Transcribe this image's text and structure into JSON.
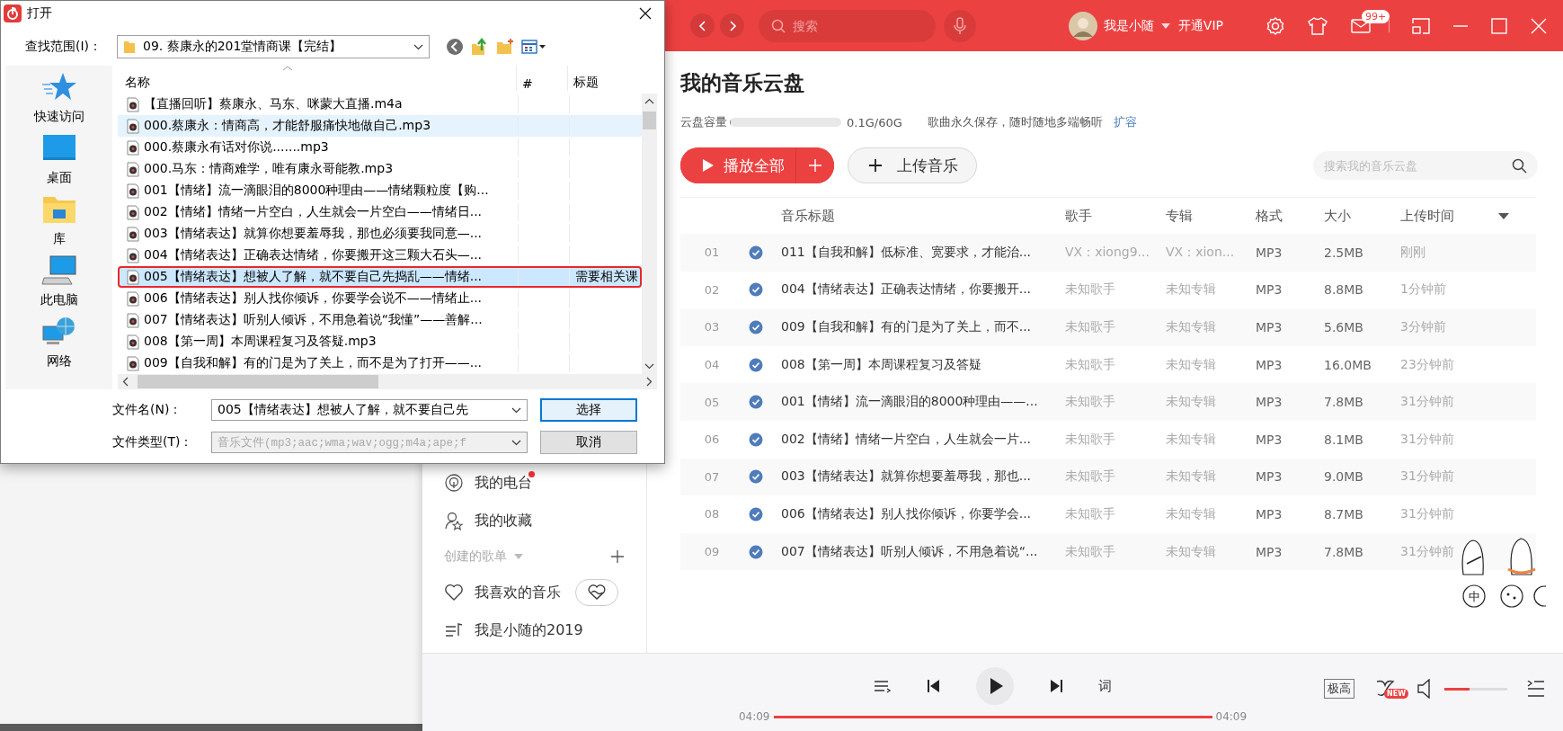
{
  "dialog": {
    "title": "打开",
    "look_in_label": "查找范围(I)：",
    "look_in_value": "09. 蔡康永的201堂情商课【完结】",
    "places": [
      {
        "label": "快速访问",
        "kind": "star"
      },
      {
        "label": "桌面",
        "kind": "desktop"
      },
      {
        "label": "库",
        "kind": "library"
      },
      {
        "label": "此电脑",
        "kind": "computer"
      },
      {
        "label": "网络",
        "kind": "network"
      }
    ],
    "columns": [
      "名称",
      "#",
      "标题"
    ],
    "files": [
      {
        "name": "【直播回听】蔡康永、马东、咪蒙大直播.m4a",
        "selected": false,
        "hovered": false,
        "marked": false
      },
      {
        "name": "000.蔡康永：情商高，才能舒服痛快地做自己.mp3",
        "selected": false,
        "hovered": true,
        "marked": false
      },
      {
        "name": "000.蔡康永有话对你说.......mp3",
        "selected": false,
        "hovered": false,
        "marked": false
      },
      {
        "name": "000.马东：情商难学，唯有康永哥能教.mp3",
        "selected": false,
        "hovered": false,
        "marked": false
      },
      {
        "name": "001【情绪】流一滴眼泪的8000种理由——情绪颗粒度【购...",
        "selected": false,
        "hovered": false,
        "marked": false
      },
      {
        "name": "002【情绪】情绪一片空白，人生就会一片空白——情绪日...",
        "selected": false,
        "hovered": false,
        "marked": false
      },
      {
        "name": "003【情绪表达】就算你想要羞辱我，那也必须要我同意—...",
        "selected": false,
        "hovered": false,
        "marked": false
      },
      {
        "name": "004【情绪表达】正确表达情绪，你要搬开这三颗大石头—...",
        "selected": false,
        "hovered": false,
        "marked": false
      },
      {
        "name": "005【情绪表达】想被人了解，就不要自己先捣乱——情绪...",
        "title": "需要相关课",
        "selected": true,
        "hovered": false,
        "marked": true
      },
      {
        "name": "006【情绪表达】别人找你倾诉，你要学会说不——情绪止...",
        "selected": false,
        "hovered": false,
        "marked": false
      },
      {
        "name": "007【情绪表达】听别人倾诉，不用急着说“我懂”——善解...",
        "selected": false,
        "hovered": false,
        "marked": false
      },
      {
        "name": "008【第一周】本周课程复习及答疑.mp3",
        "selected": false,
        "hovered": false,
        "marked": false
      },
      {
        "name": "009【自我和解】有的门是为了关上，而不是为了打开——...",
        "selected": false,
        "hovered": false,
        "marked": false
      }
    ],
    "file_name_label": "文件名(N)：",
    "file_name_value": "005【情绪表达】想被人了解，就不要自己先",
    "file_type_label": "文件类型(T)：",
    "file_type_value": "音乐文件(mp3;aac;wma;wav;ogg;m4a;ape;f",
    "buttons": [
      {
        "label": "选择",
        "default": true
      },
      {
        "label": "取消",
        "default": false
      }
    ]
  },
  "app": {
    "search_placeholder": "搜索",
    "user": "我是小随",
    "vip": "开通VIP",
    "mail_badge": "99+",
    "sidebar": {
      "items": [
        {
          "label": "我的电台",
          "kind": "radio",
          "dot": true
        },
        {
          "label": "我的收藏",
          "kind": "collect",
          "dot": false
        }
      ],
      "section": "创建的歌单",
      "playlists": [
        {
          "label": "我喜欢的音乐",
          "kind": "liked"
        },
        {
          "label": "我是小随的2019",
          "kind": "playlist"
        }
      ]
    },
    "page": {
      "title": "我的音乐云盘",
      "capacity_label": "云盘容量",
      "capacity": {
        "level": 0.01
      },
      "capacity_text": "0.1G/60G",
      "slogan": "歌曲永久保存，随时随地多端畅听",
      "expand_link": "扩容",
      "play_all": "播放全部",
      "upload": "上传音乐",
      "search_placeholder": "搜索我的音乐云盘"
    },
    "columns": [
      "音乐标题",
      "歌手",
      "专辑",
      "格式",
      "大小",
      "上传时间"
    ],
    "tracks": [
      {
        "index": "01",
        "checked": true,
        "title": "011【自我和解】低标准、宽要求，才能治...",
        "artist": "VX：xiong9...",
        "album": "VX：xion...",
        "format": "MP3",
        "size": "2.5MB",
        "time": "刚刚"
      },
      {
        "index": "02",
        "checked": true,
        "title": "004【情绪表达】正确表达情绪，你要搬开...",
        "artist": "未知歌手",
        "album": "未知专辑",
        "format": "MP3",
        "size": "8.8MB",
        "time": "1分钟前"
      },
      {
        "index": "03",
        "checked": true,
        "title": "009【自我和解】有的门是为了关上，而不...",
        "artist": "未知歌手",
        "album": "未知专辑",
        "format": "MP3",
        "size": "5.6MB",
        "time": "3分钟前"
      },
      {
        "index": "04",
        "checked": true,
        "title": "008【第一周】本周课程复习及答疑",
        "artist": "未知歌手",
        "album": "未知专辑",
        "format": "MP3",
        "size": "16.0MB",
        "time": "23分钟前"
      },
      {
        "index": "05",
        "checked": true,
        "title": "001【情绪】流一滴眼泪的8000种理由——...",
        "artist": "未知歌手",
        "album": "未知专辑",
        "format": "MP3",
        "size": "7.8MB",
        "time": "31分钟前"
      },
      {
        "index": "06",
        "checked": true,
        "title": "002【情绪】情绪一片空白，人生就会一片...",
        "artist": "未知歌手",
        "album": "未知专辑",
        "format": "MP3",
        "size": "8.1MB",
        "time": "31分钟前"
      },
      {
        "index": "07",
        "checked": true,
        "title": "003【情绪表达】就算你想要羞辱我，那也...",
        "artist": "未知歌手",
        "album": "未知专辑",
        "format": "MP3",
        "size": "9.0MB",
        "time": "31分钟前"
      },
      {
        "index": "08",
        "checked": true,
        "title": "006【情绪表达】别人找你倾诉，你要学会...",
        "artist": "未知歌手",
        "album": "未知专辑",
        "format": "MP3",
        "size": "8.7MB",
        "time": "31分钟前"
      },
      {
        "index": "09",
        "checked": true,
        "title": "007【情绪表达】听别人倾诉，不用急着说“...",
        "artist": "未知歌手",
        "album": "未知专辑",
        "format": "MP3",
        "size": "7.8MB",
        "time": "31分钟前"
      }
    ],
    "player": {
      "elapsed": "04:09",
      "total": "04:09",
      "progress": {
        "level": 1
      },
      "lyrics": "词",
      "quality": "极高",
      "effect_badge": "NEW",
      "volume": {
        "level": 0.4
      }
    },
    "sticker": {
      "label": "中"
    }
  }
}
